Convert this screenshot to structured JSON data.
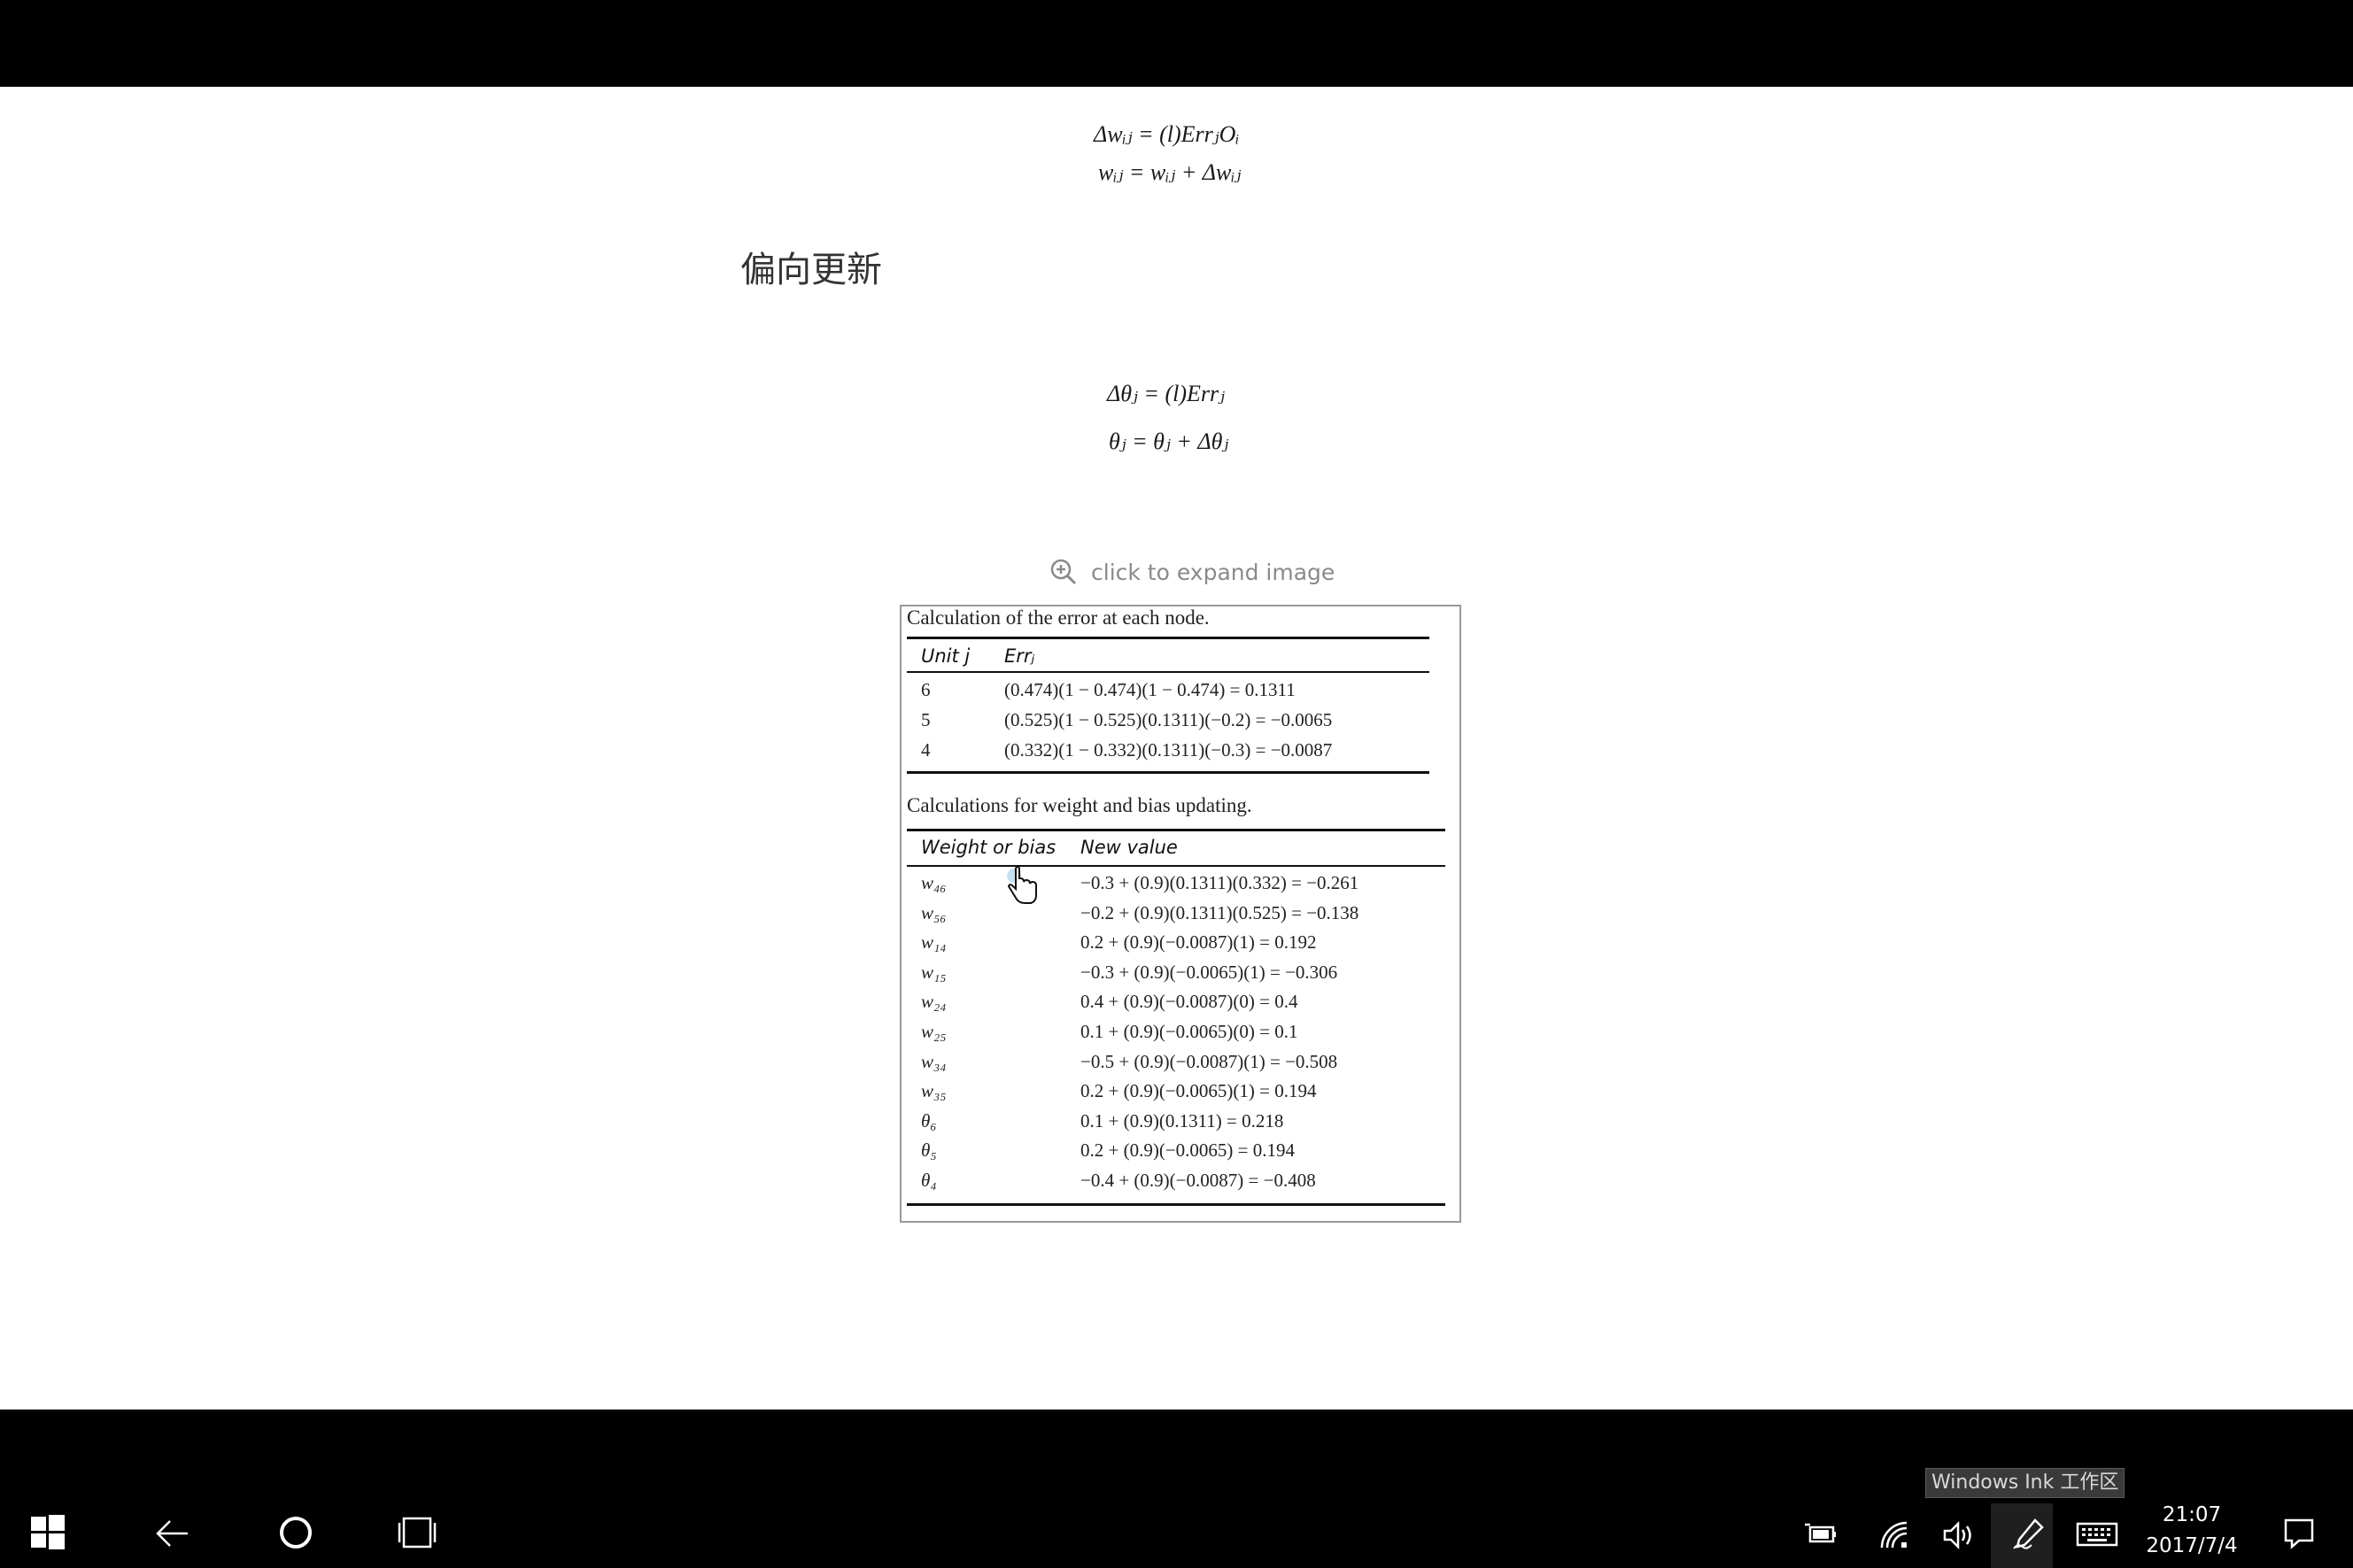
{
  "page": {
    "equations": [
      "Δwᵢⱼ = (l)ErrⱼOᵢ",
      "wᵢⱼ = wᵢⱼ + Δwᵢⱼ",
      "Δθⱼ = (l)Errⱼ",
      "θⱼ = θⱼ + Δθⱼ"
    ],
    "heading": "偏向更新",
    "expand_hint": "click to expand image"
  },
  "figure": {
    "caption1": "Calculation of the error at each node.",
    "table1": {
      "headers": [
        "Unit j",
        "Errⱼ"
      ],
      "rows": [
        [
          "6",
          "(0.474)(1 − 0.474)(1 − 0.474) = 0.1311"
        ],
        [
          "5",
          "(0.525)(1 − 0.525)(0.1311)(−0.2) = −0.0065"
        ],
        [
          "4",
          "(0.332)(1 − 0.332)(0.1311)(−0.3) = −0.0087"
        ]
      ]
    },
    "caption2": "Calculations for weight and bias updating.",
    "table2": {
      "headers": [
        "Weight or bias",
        "New value"
      ],
      "rows": [
        [
          "w₄₆",
          "−0.3 + (0.9)(0.1311)(0.332) = −0.261"
        ],
        [
          "w₅₆",
          "−0.2 + (0.9)(0.1311)(0.525) = −0.138"
        ],
        [
          "w₁₄",
          "0.2 + (0.9)(−0.0087)(1) = 0.192"
        ],
        [
          "w₁₅",
          "−0.3 + (0.9)(−0.0065)(1) = −0.306"
        ],
        [
          "w₂₄",
          "0.4 + (0.9)(−0.0087)(0) = 0.4"
        ],
        [
          "w₂₅",
          "0.1 + (0.9)(−0.0065)(0) = 0.1"
        ],
        [
          "w₃₄",
          "−0.5 + (0.9)(−0.0087)(1) = −0.508"
        ],
        [
          "w₃₅",
          "0.2 + (0.9)(−0.0065)(1) = 0.194"
        ],
        [
          "θ₆",
          "0.1 + (0.9)(0.1311) = 0.218"
        ],
        [
          "θ₅",
          "0.2 + (0.9)(−0.0065) = 0.194"
        ],
        [
          "θ₄",
          "−0.4 + (0.9)(−0.0087) = −0.408"
        ]
      ]
    }
  },
  "taskbar": {
    "start": "windows-start-icon",
    "back": "back-arrow-icon",
    "cortana": "cortana-circle-icon",
    "task_view": "task-view-icon",
    "tray_icons": [
      "power-icon",
      "network-icon",
      "volume-icon",
      "windows-ink-icon",
      "touch-keyboard-icon",
      "action-center-icon"
    ],
    "tooltip": "Windows Ink 工作区",
    "time": "21:07",
    "date": "2017/7/4"
  },
  "colors": {
    "bar": "#000000",
    "page": "#ffffff",
    "hint": "#8a8a8a",
    "tooltip_bg": "#3a3a3a"
  }
}
